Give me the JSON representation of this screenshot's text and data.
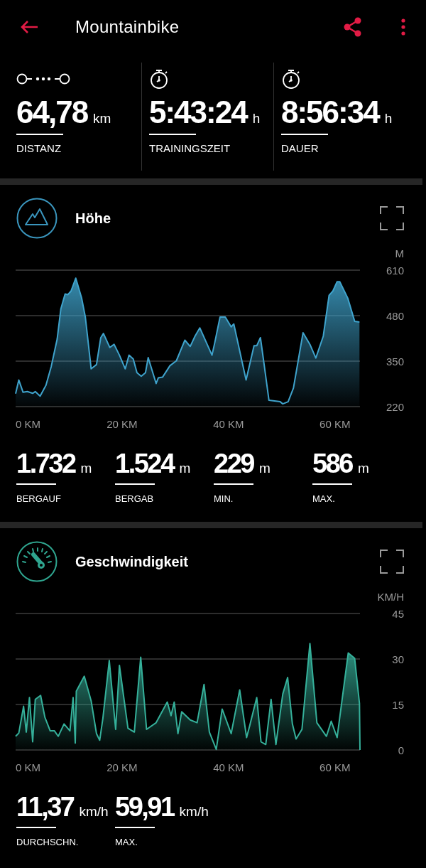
{
  "header": {
    "title": "Mountainbike"
  },
  "summary": [
    {
      "kind": "distance",
      "value": "64,78",
      "unit": "km",
      "label": "DISTANZ"
    },
    {
      "kind": "stopwatch",
      "value": "5:43:24",
      "unit": "h",
      "label": "TRAININGSZEIT"
    },
    {
      "kind": "stopwatch",
      "value": "8:56:34",
      "unit": "h",
      "label": "DAUER"
    }
  ],
  "sections": [
    {
      "kind": "altitude",
      "title": "Höhe",
      "chart_data": {
        "type": "area",
        "ylabel": "M",
        "xlim": [
          0,
          64.7
        ],
        "ylim": [
          220,
          610
        ],
        "xticks": [
          {
            "value": 0,
            "label": "0 KM"
          },
          {
            "value": 20,
            "label": "20 KM"
          },
          {
            "value": 40,
            "label": "40 KM"
          },
          {
            "value": 60,
            "label": "60 KM"
          }
        ],
        "yticks": [
          220,
          350,
          480,
          610
        ],
        "x": [
          0,
          0.6,
          1.4,
          2.2,
          3.2,
          3.7,
          4.6,
          5.7,
          6.7,
          7.8,
          8.5,
          9.3,
          9.8,
          10.4,
          11.3,
          12.4,
          13.1,
          14.2,
          15.2,
          16.0,
          16.5,
          17.7,
          18.5,
          19.5,
          20.6,
          21.3,
          22.1,
          22.8,
          23.6,
          24.4,
          24.9,
          26.4,
          26.8,
          27.6,
          29.0,
          30.2,
          31.8,
          32.8,
          33.7,
          34.6,
          36.9,
          37.4,
          38.4,
          39.4,
          40.5,
          41.0,
          43.3,
          44.8,
          45.3,
          46.0,
          46.6,
          47.6,
          49.7,
          50.2,
          51.2,
          52.2,
          54.0,
          55.3,
          56.4,
          57.8,
          58.9,
          59.6,
          60.4,
          60.9,
          62.4,
          63.7,
          64.6
        ],
        "series": [
          {
            "color": "#3fa3cc",
            "values": [
              257,
              296,
              261,
              263,
              258,
              263,
              250,
              281,
              335,
              413,
              499,
              542,
              540,
              550,
              587,
              530,
              476,
              328,
              340,
              417,
              429,
              389,
              398,
              367,
              328,
              367,
              356,
              317,
              307,
              317,
              360,
              286,
              302,
              304,
              337,
              351,
              410,
              392,
              421,
              445,
              367,
              402,
              476,
              476,
              448,
              456,
              296,
              394,
              394,
              417,
              351,
              238,
              234,
              228,
              234,
              273,
              431,
              398,
              359,
              421,
              538,
              550,
              577,
              577,
              530,
              464,
              462
            ]
          }
        ]
      },
      "stats": [
        {
          "value": "1.732",
          "unit": "m",
          "label": "BERGAUF"
        },
        {
          "value": "1.524",
          "unit": "m",
          "label": "BERGAB"
        },
        {
          "value": "229",
          "unit": "m",
          "label": "MIN."
        },
        {
          "value": "586",
          "unit": "m",
          "label": "MAX."
        }
      ]
    },
    {
      "kind": "speed",
      "title": "Geschwindigkeit",
      "chart_data": {
        "type": "area",
        "ylabel": "KM/H",
        "xlim": [
          0,
          64.7
        ],
        "ylim": [
          0,
          45
        ],
        "xticks": [
          {
            "value": 0,
            "label": "0 KM"
          },
          {
            "value": 20,
            "label": "20 KM"
          },
          {
            "value": 40,
            "label": "40 KM"
          },
          {
            "value": 60,
            "label": "60 KM"
          }
        ],
        "yticks": [
          0,
          15,
          30,
          45
        ],
        "x": [
          0,
          0.6,
          1.5,
          2.0,
          2.6,
          3.2,
          3.7,
          4.7,
          5.5,
          6.5,
          7.3,
          8.0,
          9.1,
          10.2,
          10.8,
          11.2,
          11.4,
          12.9,
          14.2,
          15.2,
          15.8,
          16.4,
          17.6,
          18.8,
          19.5,
          21.1,
          22.3,
          23.5,
          24.6,
          26.4,
          28.5,
          29.2,
          29.8,
          30.5,
          31.2,
          32.8,
          34.1,
          35.4,
          36.4,
          37.7,
          38.8,
          40.5,
          42.1,
          43.4,
          44.0,
          45.3,
          46.1,
          47.0,
          48.0,
          48.9,
          50.2,
          51.1,
          52.0,
          52.7,
          53.8,
          55.3,
          56.6,
          58.4,
          59.3,
          60.4,
          62.5,
          63.7,
          64.6,
          64.7
        ],
        "series": [
          {
            "color": "#35b09a",
            "values": [
              4.5,
              5.6,
              14.4,
              5.9,
              17.3,
              2.7,
              16.7,
              18.0,
              10.8,
              6.3,
              6.3,
              4.5,
              8.6,
              6.3,
              17.3,
              2.3,
              19.4,
              24.3,
              16.2,
              5.4,
              3.2,
              10.4,
              29.5,
              6.8,
              27.9,
              7.2,
              5.9,
              30.6,
              6.8,
              9.0,
              15.8,
              11.3,
              15.8,
              5.4,
              12.6,
              9.9,
              9.0,
              21.6,
              5.9,
              0.2,
              13.5,
              5.4,
              19.8,
              4.1,
              8.1,
              17.3,
              2.7,
              1.8,
              16.7,
              1.8,
              18.5,
              23.9,
              8.6,
              3.6,
              6.8,
              35.1,
              9.0,
              4.5,
              9.5,
              4.1,
              32.0,
              30.2,
              15.3,
              0
            ]
          }
        ]
      },
      "stats": [
        {
          "value": "11,37",
          "unit": "km/h",
          "label": "DURCHSCHN."
        },
        {
          "value": "59,91",
          "unit": "km/h",
          "label": "MAX."
        }
      ]
    }
  ]
}
